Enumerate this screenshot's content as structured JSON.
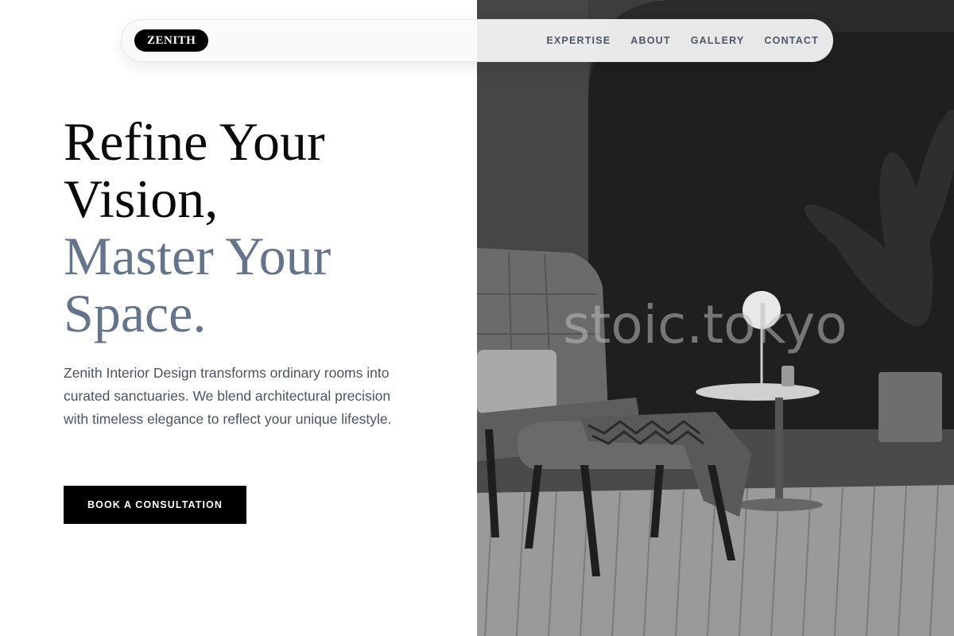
{
  "brand": {
    "logo_text": "ZENITH"
  },
  "nav": {
    "items": [
      {
        "label": "EXPERTISE"
      },
      {
        "label": "ABOUT"
      },
      {
        "label": "GALLERY"
      },
      {
        "label": "CONTACT"
      }
    ]
  },
  "hero": {
    "headline_line1": "Refine Your",
    "headline_line2": "Vision,",
    "headline_line3": "Master Your",
    "headline_line4": "Space.",
    "description": "Zenith Interior Design transforms ordinary rooms into curated sanctuaries. We blend architectural precision with timeless elegance to reflect your unique lifestyle.",
    "cta_label": "BOOK A CONSULTATION"
  },
  "image": {
    "watermark_text": "stoic.tokyo"
  },
  "colors": {
    "accent_muted": "#64748b",
    "text_primary": "#0a0a0a",
    "text_body": "#4b5563",
    "button_bg": "#000000"
  }
}
